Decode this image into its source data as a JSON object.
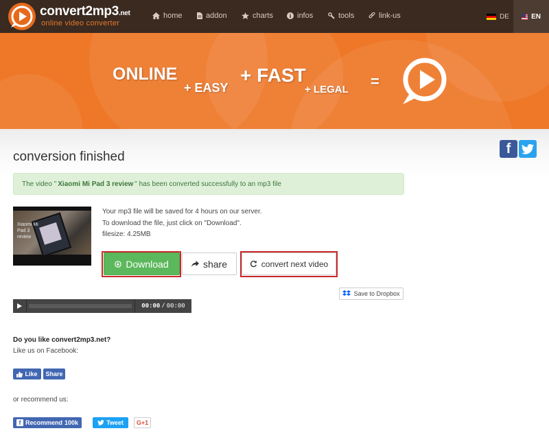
{
  "colors": {
    "nav_bg": "#3a2a20",
    "accent": "#ee7828",
    "success_bg": "#dff0d8",
    "success_text": "#3c763d",
    "download_green": "#5cb85c",
    "highlight_red": "#c9272a"
  },
  "brand": {
    "name": "convert2mp3",
    "tld": ".net",
    "tagline": "online video converter"
  },
  "nav": {
    "items": [
      {
        "label": "home",
        "icon": "home-icon"
      },
      {
        "label": "addon",
        "icon": "file-icon"
      },
      {
        "label": "charts",
        "icon": "star-icon"
      },
      {
        "label": "infos",
        "icon": "info-icon"
      },
      {
        "label": "tools",
        "icon": "tools-icon"
      },
      {
        "label": "link-us",
        "icon": "link-icon"
      }
    ],
    "languages": [
      {
        "code": "DE",
        "active": false
      },
      {
        "code": "EN",
        "active": true
      }
    ]
  },
  "banner": {
    "words": [
      "ONLINE",
      "+ EASY",
      "+ FAST",
      "+ LEGAL",
      "="
    ]
  },
  "main": {
    "title": "conversion finished",
    "alert": {
      "prefix": "The video \"",
      "video_title": "Xiaomi Mi Pad 3 review",
      "suffix": "\" has been converted successfully to an mp3 file"
    },
    "thumbnail_caption": "Xiaomi Mi Pad 3 review",
    "info_lines": [
      "Your mp3 file will be saved for 4 hours on our server.",
      "To download the file, just click on \"Download\".",
      "filesize: 4.25MB"
    ],
    "buttons": {
      "download": "Download",
      "share": "share",
      "convert_next": "convert next video"
    },
    "dropbox_label": "Save to Dropbox",
    "player": {
      "current": "00:00",
      "separator": "/",
      "duration": "00:00"
    }
  },
  "social": {
    "question": "Do you like convert2mp3.net?",
    "facebook_prompt": "Like us on Facebook:",
    "like_label": "Like",
    "share_label": "Share",
    "recommend_prompt": "or recommend us:",
    "recommend_label": "Recommend",
    "recommend_count": "100k",
    "tweet_label": "Tweet",
    "gplus_label": "G+1"
  }
}
